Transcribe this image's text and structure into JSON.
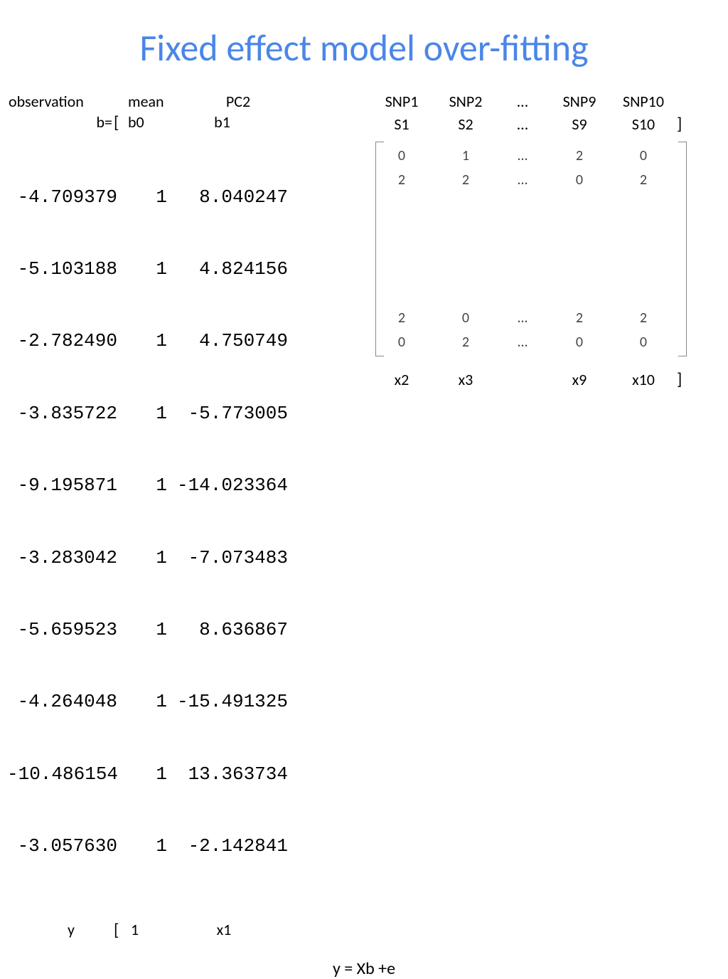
{
  "title": "Fixed effect model over-fitting",
  "left": {
    "headers": {
      "obs": "observation",
      "mean": "mean",
      "pc2": "PC2"
    },
    "b_label": "b=",
    "bracket_open": "[",
    "b0": "b0",
    "b1": "b1",
    "data": [
      {
        "obs": "-4.709379",
        "mean": "1",
        "pc2": "8.040247"
      },
      {
        "obs": "-5.103188",
        "mean": "1",
        "pc2": "4.824156"
      },
      {
        "obs": "-2.782490",
        "mean": "1",
        "pc2": "4.750749"
      },
      {
        "obs": "-3.835722",
        "mean": "1",
        "pc2": "-5.773005"
      },
      {
        "obs": "-9.195871",
        "mean": "1",
        "pc2": "-14.023364"
      },
      {
        "obs": "-3.283042",
        "mean": "1",
        "pc2": "-7.073483"
      },
      {
        "obs": "-5.659523",
        "mean": "1",
        "pc2": "8.636867"
      },
      {
        "obs": "-4.264048",
        "mean": "1",
        "pc2": "-15.491325"
      },
      {
        "obs": "-10.486154",
        "mean": "1",
        "pc2": "13.363734"
      },
      {
        "obs": "-3.057630",
        "mean": "1",
        "pc2": "-2.142841"
      }
    ],
    "bottom": {
      "y": "y",
      "bracket_open": "[",
      "one": "1",
      "x1": "x1"
    }
  },
  "right": {
    "snp": [
      "SNP1",
      "SNP2",
      "…",
      "SNP9",
      "SNP10"
    ],
    "s": [
      "S1",
      "S2",
      "…",
      "S9",
      "S10"
    ],
    "s_bracket_close": "]",
    "matrix": {
      "top_rows": [
        [
          "0",
          "1",
          "…",
          "2",
          "0"
        ],
        [
          "2",
          "2",
          "…",
          "0",
          "2"
        ]
      ],
      "bottom_rows": [
        [
          "2",
          "0",
          "…",
          "2",
          "2"
        ],
        [
          "0",
          "2",
          "…",
          "0",
          "0"
        ]
      ]
    },
    "x": [
      "x2",
      "x3",
      "",
      "x9",
      "x10"
    ],
    "x_bracket_close": "]"
  },
  "equation": "y = Xb +e"
}
